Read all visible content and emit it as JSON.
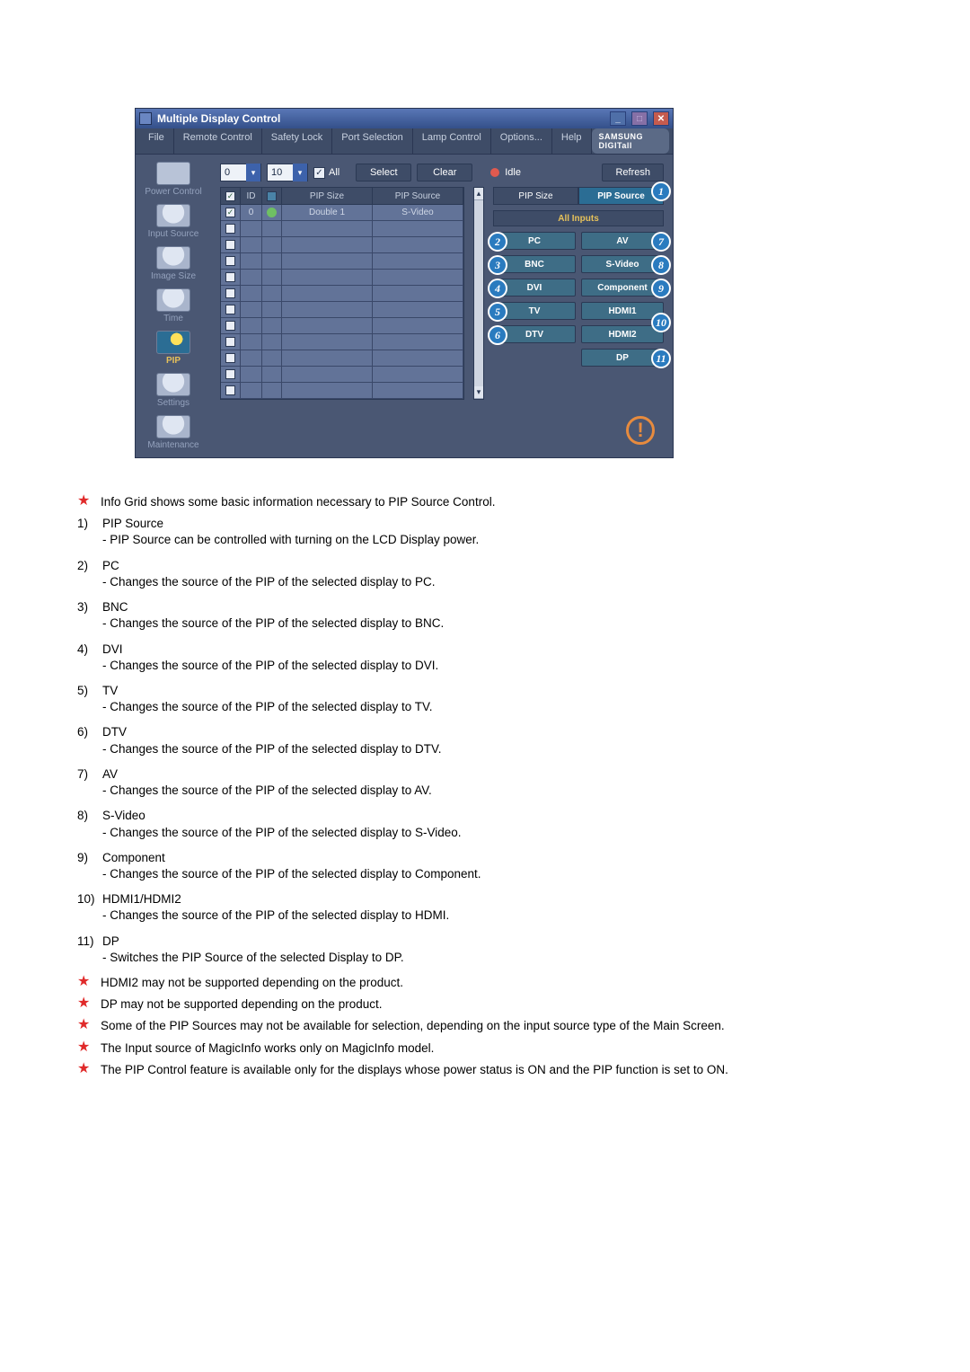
{
  "window": {
    "title": "Multiple Display Control",
    "brand": "SAMSUNG DIGITall"
  },
  "menus": [
    "File",
    "Remote Control",
    "Safety Lock",
    "Port Selection",
    "Lamp Control",
    "Options...",
    "Help"
  ],
  "sidebar": {
    "items": [
      {
        "label": "Power Control"
      },
      {
        "label": "Input Source"
      },
      {
        "label": "Image Size"
      },
      {
        "label": "Time"
      },
      {
        "label": "PIP",
        "active": true
      },
      {
        "label": "Settings"
      },
      {
        "label": "Maintenance"
      }
    ]
  },
  "topbar": {
    "sel1": "0",
    "sel2": "10",
    "all": "All",
    "select": "Select",
    "clear": "Clear",
    "idle": "Idle",
    "refresh": "Refresh"
  },
  "grid": {
    "headers": {
      "chk": "",
      "id": "ID",
      "ind": "",
      "size": "PIP Size",
      "src": "PIP Source"
    },
    "rows": [
      {
        "checked": true,
        "id": "0",
        "on": true,
        "size": "Double 1",
        "src": "S-Video"
      }
    ],
    "blank_rows": 11
  },
  "right": {
    "tabs": {
      "size": "PIP Size",
      "source": "PIP Source"
    },
    "all": "All Inputs",
    "left_col": [
      "PC",
      "BNC",
      "DVI",
      "TV",
      "DTV"
    ],
    "right_col": [
      "AV",
      "S-Video",
      "Component",
      "HDMI1",
      "HDMI2",
      "DP"
    ]
  },
  "callouts": {
    "1": "1",
    "2": "2",
    "3": "3",
    "4": "4",
    "5": "5",
    "6": "6",
    "7": "7",
    "8": "8",
    "9": "9",
    "10": "10",
    "11": "11"
  },
  "doc": {
    "intro": "Info Grid shows some basic information necessary to PIP Source Control.",
    "items": [
      {
        "n": "1)",
        "term": "PIP Source",
        "desc": "- PIP Source can be controlled with turning on the LCD Display power."
      },
      {
        "n": "2)",
        "term": "PC",
        "desc": "- Changes the source of the PIP of the selected display to PC."
      },
      {
        "n": "3)",
        "term": "BNC",
        "desc": "- Changes the source of the PIP of the selected display to BNC."
      },
      {
        "n": "4)",
        "term": "DVI",
        "desc": "- Changes the source of the PIP of the selected display to DVI."
      },
      {
        "n": "5)",
        "term": "TV",
        "desc": "- Changes the source of the PIP of the selected display to TV."
      },
      {
        "n": "6)",
        "term": "DTV",
        "desc": "- Changes the source of the PIP of the selected display to DTV."
      },
      {
        "n": "7)",
        "term": "AV",
        "desc": "- Changes the source of the PIP of the selected display to AV."
      },
      {
        "n": "8)",
        "term": "S-Video",
        "desc": "- Changes the source of the PIP of the selected display to S-Video."
      },
      {
        "n": "9)",
        "term": "Component",
        "desc": "- Changes the source of the PIP of the selected display to Component."
      },
      {
        "n": "10)",
        "term": "HDMI1/HDMI2",
        "desc": "- Changes the source of the PIP of the selected display to HDMI."
      },
      {
        "n": "11)",
        "term": "DP",
        "desc": "- Switches the PIP Source of the selected Display to DP."
      }
    ],
    "notes": [
      "HDMI2 may not be supported depending on the product.",
      "DP may not be supported depending on the product.",
      "Some of the PIP Sources may not be available for selection, depending on the input source type of the Main Screen.",
      "The Input source of MagicInfo works only on MagicInfo model.",
      "The PIP Control feature is available only for the displays whose power status is ON and the PIP function is set to ON."
    ]
  }
}
